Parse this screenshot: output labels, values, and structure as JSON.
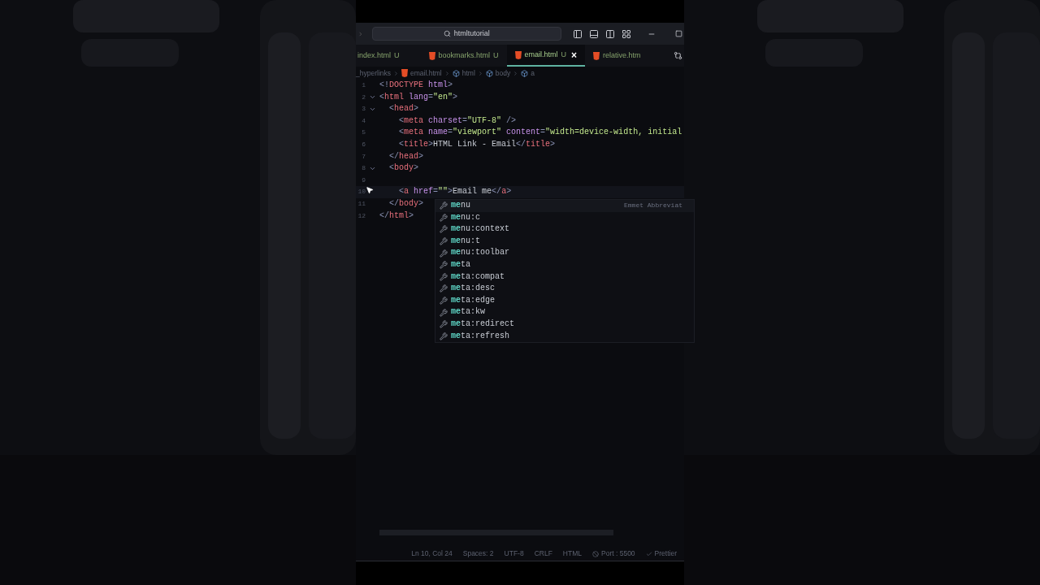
{
  "title_bar": {
    "search": "htmltutorial"
  },
  "tabs": [
    {
      "label": "index.html",
      "badge": "U",
      "icon": false,
      "selected": false
    },
    {
      "label": "bookmarks.html",
      "badge": "U",
      "icon": true,
      "selected": false
    },
    {
      "label": "email.html",
      "badge": "U",
      "icon": true,
      "selected": true,
      "close": "×"
    },
    {
      "label": "relative.htm",
      "icon": true,
      "selected": false
    }
  ],
  "breadcrumbs": [
    {
      "label": "_hyperlinks",
      "kind": "folder"
    },
    {
      "label": "email.html",
      "kind": "file"
    },
    {
      "label": "html",
      "kind": "symbol"
    },
    {
      "label": "body",
      "kind": "symbol"
    },
    {
      "label": "a",
      "kind": "symbol"
    }
  ],
  "editor": {
    "lines": [
      {
        "number": "1",
        "fold": false,
        "tokens": [
          {
            "text": "<!",
            "kind": "punct"
          },
          {
            "text": "DOCTYPE",
            "kind": "tag"
          },
          {
            "text": " html",
            "kind": "attr"
          },
          {
            "text": ">",
            "kind": "punct"
          }
        ]
      },
      {
        "number": "2",
        "fold": true,
        "tokens": [
          {
            "text": "<",
            "kind": "punct"
          },
          {
            "text": "html",
            "kind": "tag"
          },
          {
            "text": " lang",
            "kind": "attr"
          },
          {
            "text": "=",
            "kind": "punct"
          },
          {
            "text": "\"en\"",
            "kind": "string"
          },
          {
            "text": ">",
            "kind": "punct"
          }
        ]
      },
      {
        "number": "3",
        "fold": true,
        "tokens": [
          {
            "text": "  <",
            "kind": "punct"
          },
          {
            "text": "head",
            "kind": "tag"
          },
          {
            "text": ">",
            "kind": "punct"
          }
        ]
      },
      {
        "number": "4",
        "fold": false,
        "tokens": [
          {
            "text": "    <",
            "kind": "punct"
          },
          {
            "text": "meta",
            "kind": "tag"
          },
          {
            "text": " charset",
            "kind": "attr"
          },
          {
            "text": "=",
            "kind": "punct"
          },
          {
            "text": "\"UTF-8\"",
            "kind": "string"
          },
          {
            "text": " />",
            "kind": "punct"
          }
        ]
      },
      {
        "number": "5",
        "fold": false,
        "tokens": [
          {
            "text": "    <",
            "kind": "punct"
          },
          {
            "text": "meta",
            "kind": "tag"
          },
          {
            "text": " name",
            "kind": "attr"
          },
          {
            "text": "=",
            "kind": "punct"
          },
          {
            "text": "\"viewport\"",
            "kind": "string"
          },
          {
            "text": " content",
            "kind": "attr"
          },
          {
            "text": "=",
            "kind": "punct"
          },
          {
            "text": "\"width=device-width, initial",
            "kind": "string"
          }
        ]
      },
      {
        "number": "6",
        "fold": false,
        "tokens": [
          {
            "text": "    <",
            "kind": "punct"
          },
          {
            "text": "title",
            "kind": "tag"
          },
          {
            "text": ">",
            "kind": "punct"
          },
          {
            "text": "HTML Link - Email",
            "kind": "plain"
          },
          {
            "text": "</",
            "kind": "punct"
          },
          {
            "text": "title",
            "kind": "tag"
          },
          {
            "text": ">",
            "kind": "punct"
          }
        ]
      },
      {
        "number": "7",
        "fold": false,
        "tokens": [
          {
            "text": "  </",
            "kind": "punct"
          },
          {
            "text": "head",
            "kind": "tag"
          },
          {
            "text": ">",
            "kind": "punct"
          }
        ]
      },
      {
        "number": "8",
        "fold": true,
        "tokens": [
          {
            "text": "  <",
            "kind": "punct"
          },
          {
            "text": "body",
            "kind": "tag"
          },
          {
            "text": ">",
            "kind": "punct"
          }
        ]
      },
      {
        "number": "9",
        "fold": false
      },
      {
        "number": "10",
        "fold": false,
        "current": true,
        "tokens": [
          {
            "text": "    <",
            "kind": "punct"
          },
          {
            "text": "a",
            "kind": "tag"
          },
          {
            "text": " href",
            "kind": "attr"
          },
          {
            "text": "=",
            "kind": "punct"
          },
          {
            "text": "\"\"",
            "kind": "string"
          },
          {
            "text": ">",
            "kind": "punct"
          },
          {
            "text": "Email me",
            "kind": "plain"
          },
          {
            "text": "</",
            "kind": "punct"
          },
          {
            "text": "a",
            "kind": "tag"
          },
          {
            "text": ">",
            "kind": "punct"
          }
        ]
      },
      {
        "number": "11",
        "fold": false,
        "tokens": [
          {
            "text": "  </",
            "kind": "punct"
          },
          {
            "text": "body",
            "kind": "tag"
          },
          {
            "text": ">",
            "kind": "punct"
          }
        ]
      },
      {
        "number": "12",
        "fold": false,
        "tokens": [
          {
            "text": "</",
            "kind": "punct"
          },
          {
            "text": "html",
            "kind": "tag"
          },
          {
            "text": ">",
            "kind": "punct"
          }
        ]
      }
    ]
  },
  "suggestions": {
    "detail": "Emmet Abbreviat",
    "items": [
      {
        "match": "me",
        "rest": "nu",
        "selected": true
      },
      {
        "match": "me",
        "rest": "nu:c",
        "selected": false
      },
      {
        "match": "me",
        "rest": "nu:context",
        "selected": false
      },
      {
        "match": "me",
        "rest": "nu:t",
        "selected": false
      },
      {
        "match": "me",
        "rest": "nu:toolbar",
        "selected": false
      },
      {
        "match": "me",
        "rest": "ta",
        "selected": false
      },
      {
        "match": "me",
        "rest": "ta:compat",
        "selected": false
      },
      {
        "match": "me",
        "rest": "ta:desc",
        "selected": false
      },
      {
        "match": "me",
        "rest": "ta:edge",
        "selected": false
      },
      {
        "match": "me",
        "rest": "ta:kw",
        "selected": false
      },
      {
        "match": "me",
        "rest": "ta:redirect",
        "selected": false
      },
      {
        "match": "me",
        "rest": "ta:refresh",
        "selected": false
      }
    ]
  },
  "status_bar": [
    {
      "label": "Ln 10, Col 24",
      "kind": "text"
    },
    {
      "label": "Spaces: 2",
      "kind": "text"
    },
    {
      "label": "UTF-8",
      "kind": "text"
    },
    {
      "label": "CRLF",
      "kind": "text"
    },
    {
      "label": "HTML",
      "kind": "text"
    },
    {
      "label": "Port : 5500",
      "kind": "port"
    },
    {
      "label": "Prettier",
      "kind": "check"
    }
  ]
}
